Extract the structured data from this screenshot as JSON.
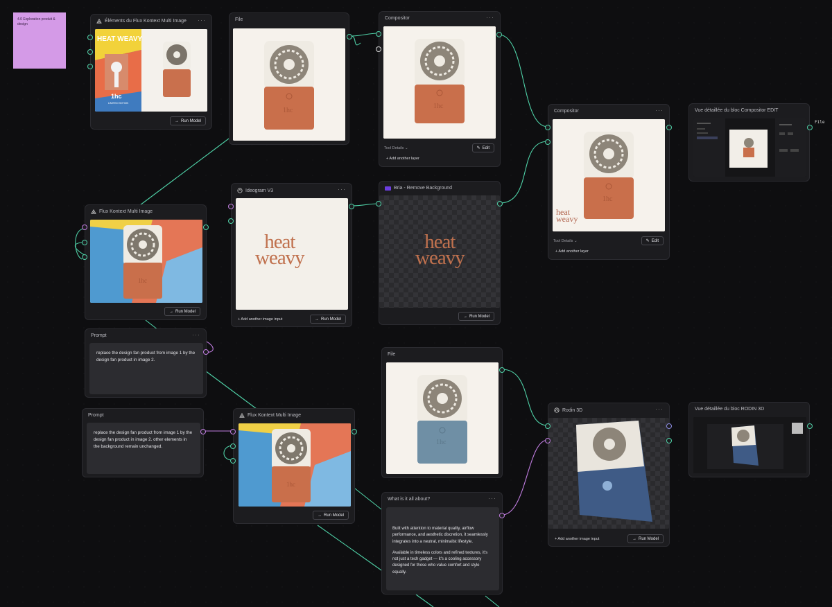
{
  "sticky_note": "4.0 Exploration produit & design",
  "nodes": {
    "elements_flux": {
      "title": "Éléments du Flux Kontext Multi Image",
      "run": "Run Model",
      "poster_title": "HEAT WEAVY",
      "poster_brand": "1hc",
      "poster_sub": "LIMITED EDITION"
    },
    "file_top": {
      "title": "File"
    },
    "compositor_top": {
      "title": "Compositor",
      "tool_details": "Tool Details",
      "edit": "Edit",
      "add_layer": "+ Add another layer"
    },
    "compositor_mid": {
      "title": "Compositor",
      "tool_details": "Tool Details",
      "edit": "Edit",
      "add_layer": "+ Add another layer"
    },
    "vue_compositor": {
      "title": "Vue détaillée du bloc Compositor EDIT",
      "side": "File"
    },
    "flux_mid": {
      "title": "Flux Kontext Multi Image",
      "run": "Run Model"
    },
    "ideogram": {
      "title": "Ideogram V3",
      "add_input": "+ Add another image input",
      "run": "Run Model",
      "logo_l1": "heat",
      "logo_l2": "weavy"
    },
    "bria": {
      "title": "Bria - Remove Background",
      "run": "Run Model",
      "logo_l1": "heat",
      "logo_l2": "weavy"
    },
    "prompt1": {
      "title": "Prompt",
      "text": "replace the design fan product from image 1 by the design fan product in image 2."
    },
    "prompt2": {
      "title": "Prompt",
      "text": "replace the design fan product from image 1 by the design fan product in image 2. other elements in the background remain unchanged."
    },
    "flux_bottom": {
      "title": "Flux Kontext Multi Image",
      "run": "Run Model"
    },
    "file_bottom": {
      "title": "File"
    },
    "about": {
      "title": "What is it all about?",
      "p1": "Built with attention to material quality, airflow performance, and aesthetic discretion, it seamlessly integrates into a neutral, minimalist lifestyle.",
      "p2": "Available in timeless colors and refined textures, it's not just a tech gadget — it's a cooling accessory designed for those who value comfort and style equally."
    },
    "rodin": {
      "title": "Rodin 3D",
      "add_input": "+ Add another image input",
      "run": "Run Model"
    },
    "vue_rodin": {
      "title": "Vue détaillée du bloc RODIN 3D"
    }
  },
  "product_logo": "1hc",
  "compositor_logo_l1": "heat",
  "compositor_logo_l2": "weavy",
  "colors": {
    "wire_green": "#4fd1a7",
    "wire_pink": "#c07de0",
    "fan_orange": "#c9704d",
    "fan_blue": "#6f8fa5",
    "sticky": "#d49ae7"
  }
}
